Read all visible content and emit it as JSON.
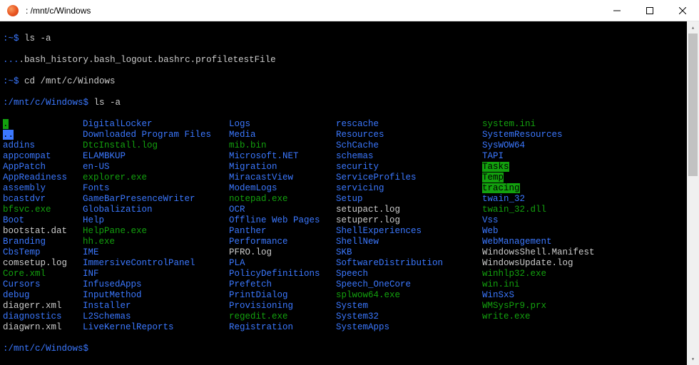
{
  "window": {
    "title": ": /mnt/c/Windows"
  },
  "prompts": {
    "p1_path": ":~$",
    "p1_cmd": " ls -a",
    "p2_path": ":~$",
    "p2_cmd": " cd /mnt/c/Windows",
    "p3_path": ":/mnt/c/Windows$",
    "p3_cmd": " ls -a",
    "p4_path": ":/mnt/c/Windows$",
    "p4_cmd": ""
  },
  "home_ls": {
    "dot": ".",
    "dotdot": "..",
    "f1": ".bash_history",
    "f2": ".bash_logout",
    "f3": ".bashrc",
    "f4": ".profile",
    "f5": "testFile"
  },
  "listing": [
    {
      "c1": {
        "t": ".",
        "cls": "hg"
      },
      "c2": {
        "t": "DigitalLocker",
        "cls": "b"
      },
      "c3": {
        "t": "Logs",
        "cls": "b"
      },
      "c4": {
        "t": "rescache",
        "cls": "b"
      },
      "c5": {
        "t": "system.ini",
        "cls": "g"
      }
    },
    {
      "c1": {
        "t": "..",
        "cls": "hb"
      },
      "c2": {
        "t": "Downloaded Program Files",
        "cls": "b"
      },
      "c3": {
        "t": "Media",
        "cls": "b"
      },
      "c4": {
        "t": "Resources",
        "cls": "b"
      },
      "c5": {
        "t": "SystemResources",
        "cls": "b"
      }
    },
    {
      "c1": {
        "t": "addins",
        "cls": "b"
      },
      "c2": {
        "t": "DtcInstall.log",
        "cls": "g"
      },
      "c3": {
        "t": "mib.bin",
        "cls": "g"
      },
      "c4": {
        "t": "SchCache",
        "cls": "b"
      },
      "c5": {
        "t": "SysWOW64",
        "cls": "b"
      }
    },
    {
      "c1": {
        "t": "appcompat",
        "cls": "b"
      },
      "c2": {
        "t": "ELAMBKUP",
        "cls": "b"
      },
      "c3": {
        "t": "Microsoft.NET",
        "cls": "b"
      },
      "c4": {
        "t": "schemas",
        "cls": "b"
      },
      "c5": {
        "t": "TAPI",
        "cls": "b"
      }
    },
    {
      "c1": {
        "t": "AppPatch",
        "cls": "b"
      },
      "c2": {
        "t": "en-US",
        "cls": "b"
      },
      "c3": {
        "t": "Migration",
        "cls": "b"
      },
      "c4": {
        "t": "security",
        "cls": "b"
      },
      "c5": {
        "t": "Tasks",
        "cls": "hg"
      }
    },
    {
      "c1": {
        "t": "AppReadiness",
        "cls": "b"
      },
      "c2": {
        "t": "explorer.exe",
        "cls": "g"
      },
      "c3": {
        "t": "MiracastView",
        "cls": "b"
      },
      "c4": {
        "t": "ServiceProfiles",
        "cls": "b"
      },
      "c5": {
        "t": "Temp",
        "cls": "hg"
      }
    },
    {
      "c1": {
        "t": "assembly",
        "cls": "b"
      },
      "c2": {
        "t": "Fonts",
        "cls": "b"
      },
      "c3": {
        "t": "ModemLogs",
        "cls": "b"
      },
      "c4": {
        "t": "servicing",
        "cls": "b"
      },
      "c5": {
        "t": "tracing",
        "cls": "hg"
      }
    },
    {
      "c1": {
        "t": "bcastdvr",
        "cls": "b"
      },
      "c2": {
        "t": "GameBarPresenceWriter",
        "cls": "b"
      },
      "c3": {
        "t": "notepad.exe",
        "cls": "g"
      },
      "c4": {
        "t": "Setup",
        "cls": "b"
      },
      "c5": {
        "t": "twain_32",
        "cls": "b"
      }
    },
    {
      "c1": {
        "t": "bfsvc.exe",
        "cls": "g"
      },
      "c2": {
        "t": "Globalization",
        "cls": "b"
      },
      "c3": {
        "t": "OCR",
        "cls": "b"
      },
      "c4": {
        "t": "setupact.log",
        "cls": "w"
      },
      "c5": {
        "t": "twain_32.dll",
        "cls": "g"
      }
    },
    {
      "c1": {
        "t": "Boot",
        "cls": "b"
      },
      "c2": {
        "t": "Help",
        "cls": "b"
      },
      "c3": {
        "t": "Offline Web Pages",
        "cls": "b"
      },
      "c4": {
        "t": "setuperr.log",
        "cls": "w"
      },
      "c5": {
        "t": "Vss",
        "cls": "b"
      }
    },
    {
      "c1": {
        "t": "bootstat.dat",
        "cls": "w"
      },
      "c2": {
        "t": "HelpPane.exe",
        "cls": "g"
      },
      "c3": {
        "t": "Panther",
        "cls": "b"
      },
      "c4": {
        "t": "ShellExperiences",
        "cls": "b"
      },
      "c5": {
        "t": "Web",
        "cls": "b"
      }
    },
    {
      "c1": {
        "t": "Branding",
        "cls": "b"
      },
      "c2": {
        "t": "hh.exe",
        "cls": "g"
      },
      "c3": {
        "t": "Performance",
        "cls": "b"
      },
      "c4": {
        "t": "ShellNew",
        "cls": "b"
      },
      "c5": {
        "t": "WebManagement",
        "cls": "b"
      }
    },
    {
      "c1": {
        "t": "CbsTemp",
        "cls": "b"
      },
      "c2": {
        "t": "IME",
        "cls": "b"
      },
      "c3": {
        "t": "PFRO.log",
        "cls": "w"
      },
      "c4": {
        "t": "SKB",
        "cls": "b"
      },
      "c5": {
        "t": "WindowsShell.Manifest",
        "cls": "w"
      }
    },
    {
      "c1": {
        "t": "comsetup.log",
        "cls": "w"
      },
      "c2": {
        "t": "ImmersiveControlPanel",
        "cls": "b"
      },
      "c3": {
        "t": "PLA",
        "cls": "b"
      },
      "c4": {
        "t": "SoftwareDistribution",
        "cls": "b"
      },
      "c5": {
        "t": "WindowsUpdate.log",
        "cls": "w"
      }
    },
    {
      "c1": {
        "t": "Core.xml",
        "cls": "g"
      },
      "c2": {
        "t": "INF",
        "cls": "b"
      },
      "c3": {
        "t": "PolicyDefinitions",
        "cls": "b"
      },
      "c4": {
        "t": "Speech",
        "cls": "b"
      },
      "c5": {
        "t": "winhlp32.exe",
        "cls": "g"
      }
    },
    {
      "c1": {
        "t": "Cursors",
        "cls": "b"
      },
      "c2": {
        "t": "InfusedApps",
        "cls": "b"
      },
      "c3": {
        "t": "Prefetch",
        "cls": "b"
      },
      "c4": {
        "t": "Speech_OneCore",
        "cls": "b"
      },
      "c5": {
        "t": "win.ini",
        "cls": "g"
      }
    },
    {
      "c1": {
        "t": "debug",
        "cls": "b"
      },
      "c2": {
        "t": "InputMethod",
        "cls": "b"
      },
      "c3": {
        "t": "PrintDialog",
        "cls": "b"
      },
      "c4": {
        "t": "splwow64.exe",
        "cls": "g"
      },
      "c5": {
        "t": "WinSxS",
        "cls": "b"
      }
    },
    {
      "c1": {
        "t": "diagerr.xml",
        "cls": "w"
      },
      "c2": {
        "t": "Installer",
        "cls": "b"
      },
      "c3": {
        "t": "Provisioning",
        "cls": "b"
      },
      "c4": {
        "t": "System",
        "cls": "b"
      },
      "c5": {
        "t": "WMSysPr9.prx",
        "cls": "g"
      }
    },
    {
      "c1": {
        "t": "diagnostics",
        "cls": "b"
      },
      "c2": {
        "t": "L2Schemas",
        "cls": "b"
      },
      "c3": {
        "t": "regedit.exe",
        "cls": "g"
      },
      "c4": {
        "t": "System32",
        "cls": "b"
      },
      "c5": {
        "t": "write.exe",
        "cls": "g"
      }
    },
    {
      "c1": {
        "t": "diagwrn.xml",
        "cls": "w"
      },
      "c2": {
        "t": "LiveKernelReports",
        "cls": "b"
      },
      "c3": {
        "t": "Registration",
        "cls": "b"
      },
      "c4": {
        "t": "SystemApps",
        "cls": "b"
      },
      "c5": {
        "t": "",
        "cls": "w"
      }
    }
  ]
}
